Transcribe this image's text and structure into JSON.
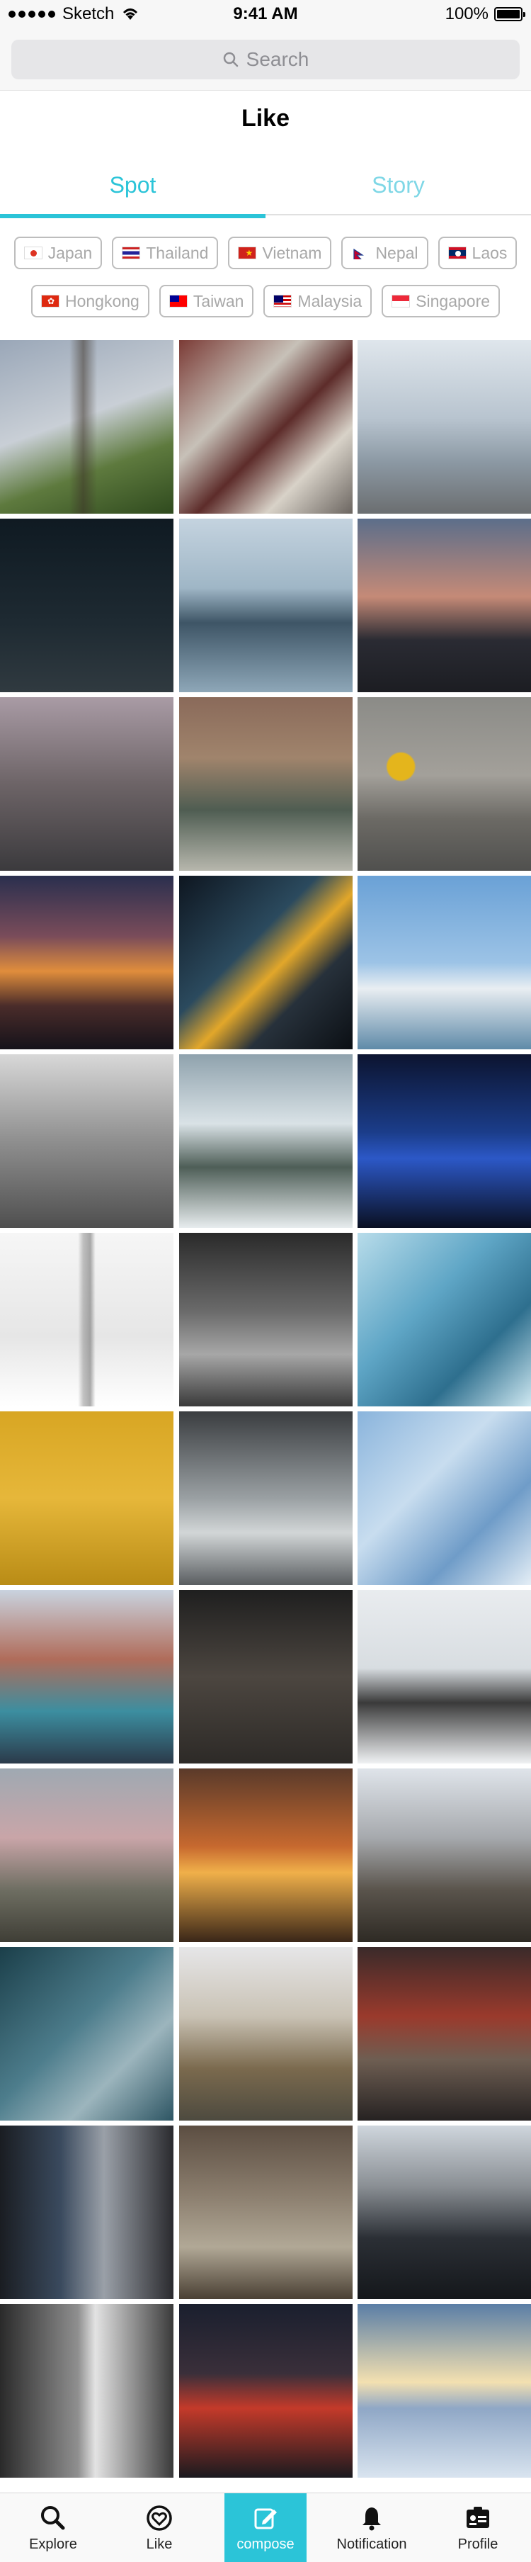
{
  "status_bar": {
    "carrier": "Sketch",
    "time": "9:41 AM",
    "battery": "100%",
    "icons": [
      "signal-dots-icon",
      "wifi-icon",
      "battery-icon"
    ]
  },
  "search": {
    "placeholder": "Search",
    "icon": "search-icon"
  },
  "page": {
    "title": "Like"
  },
  "tabs": [
    {
      "label": "Spot",
      "active": true
    },
    {
      "label": "Story",
      "active": false
    }
  ],
  "countries": {
    "row1": [
      {
        "label": "Japan",
        "flag": "jp"
      },
      {
        "label": "Thailand",
        "flag": "th"
      },
      {
        "label": "Vietnam",
        "flag": "vn"
      },
      {
        "label": "Nepal",
        "flag": "np"
      },
      {
        "label": "Laos",
        "flag": "la"
      }
    ],
    "row2": [
      {
        "label": "Hongkong",
        "flag": "hk"
      },
      {
        "label": "Taiwan",
        "flag": "tw"
      },
      {
        "label": "Malaysia",
        "flag": "my"
      },
      {
        "label": "Singapore",
        "flag": "sg"
      }
    ]
  },
  "photos_count_visible": 36,
  "bottom_nav": [
    {
      "label": "Explore",
      "icon": "search-icon"
    },
    {
      "label": "Like",
      "icon": "heart-icon"
    },
    {
      "label": "compose",
      "icon": "compose-icon",
      "active": true
    },
    {
      "label": "Notification",
      "icon": "bell-icon"
    },
    {
      "label": "Profile",
      "icon": "profile-card-icon"
    }
  ],
  "colors": {
    "accent": "#2bc4d8",
    "chip_border": "#bdbdbd",
    "chip_text": "#a8a8a8"
  }
}
